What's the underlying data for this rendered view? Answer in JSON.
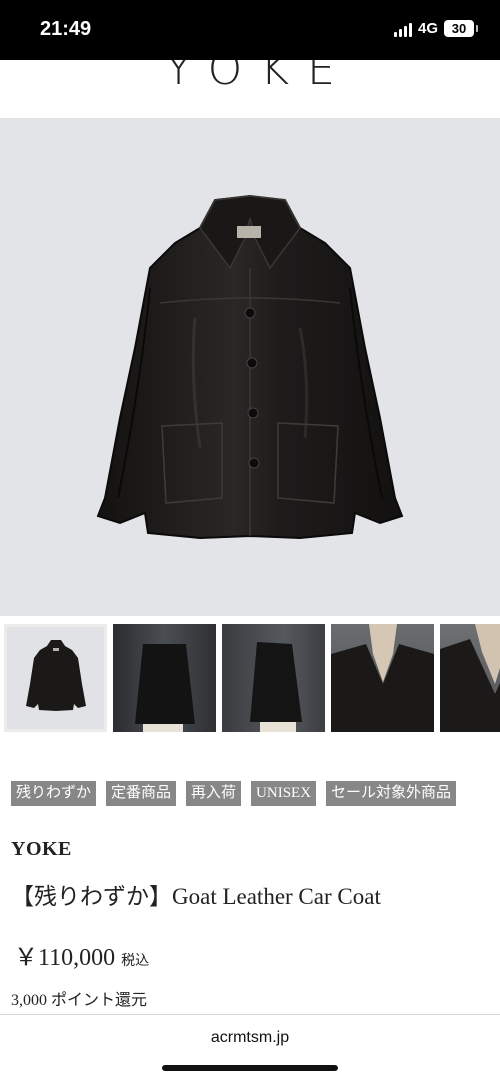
{
  "status_bar": {
    "time": "21:49",
    "network": "4G",
    "battery": "30"
  },
  "brand_header": {
    "logo": "YOKE"
  },
  "hero": {
    "alt": "Goat Leather Car Coat main image",
    "icon": "leather-coat-image"
  },
  "thumbnails": [
    {
      "label": "thumbnail-1",
      "active": true
    },
    {
      "label": "thumbnail-2",
      "active": false
    },
    {
      "label": "thumbnail-3",
      "active": false
    },
    {
      "label": "thumbnail-4",
      "active": false
    },
    {
      "label": "thumbnail-5",
      "active": false
    }
  ],
  "tags": [
    "残りわずか",
    "定番商品",
    "再入荷",
    "UNISEX",
    "セール対象外商品"
  ],
  "product": {
    "brand": "YOKE",
    "title": "【残りわずか】Goat Leather Car Coat",
    "price": "￥110,000",
    "tax_label": "税込",
    "points": "3,000 ポイント還元"
  },
  "browser": {
    "url": "acrmtsm.jp"
  },
  "colors": {
    "tag_bg": "#878787",
    "hero_bg": "#e2e4e7",
    "coat": "#1c1a19"
  }
}
